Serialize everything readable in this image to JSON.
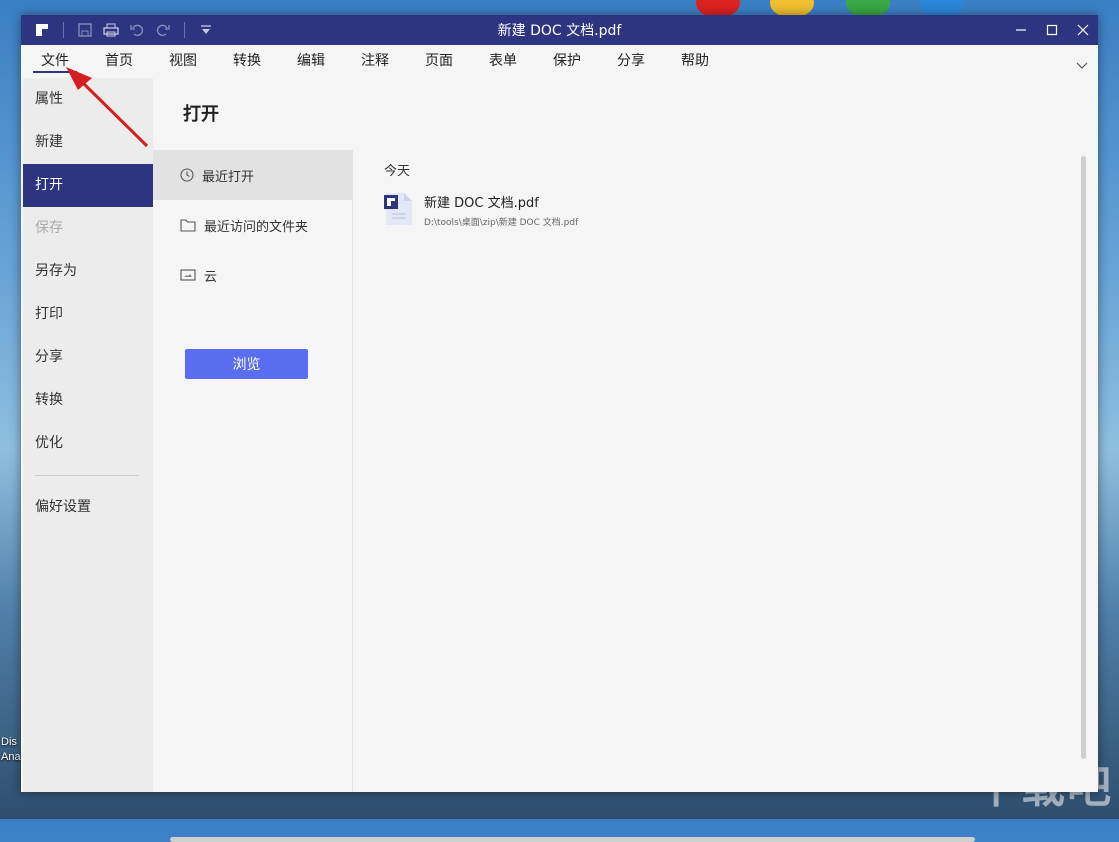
{
  "window": {
    "title": "新建 DOC 文档.pdf"
  },
  "quick_toolbar": {
    "icons": [
      "app-logo-icon",
      "save-icon",
      "print-icon",
      "undo-icon",
      "redo-icon",
      "customize-icon"
    ]
  },
  "menubar": {
    "items": [
      "文件",
      "首页",
      "视图",
      "转换",
      "编辑",
      "注释",
      "页面",
      "表单",
      "保护",
      "分享",
      "帮助"
    ],
    "active": "文件"
  },
  "sidebar": {
    "items": [
      "属性",
      "新建",
      "打开",
      "保存",
      "另存为",
      "打印",
      "分享",
      "转换",
      "优化"
    ],
    "active": "打开",
    "disabled": "保存",
    "bottom_item": "偏好设置"
  },
  "panel": {
    "title": "打开",
    "subnav": [
      "最近打开",
      "最近访问的文件夹",
      "云"
    ],
    "browse_label": "浏览"
  },
  "recent": {
    "group_label": "今天",
    "files": [
      {
        "name": "新建 DOC 文档.pdf",
        "path": "D:\\tools\\桌面\\zip\\新建 DOC 文档.pdf"
      }
    ]
  },
  "desktop": {
    "label": "Dis\nAna",
    "watermark": "下载吧"
  },
  "colors": {
    "accent": "#2d3580",
    "button": "#5a6cf0",
    "arrow": "#d42020"
  }
}
